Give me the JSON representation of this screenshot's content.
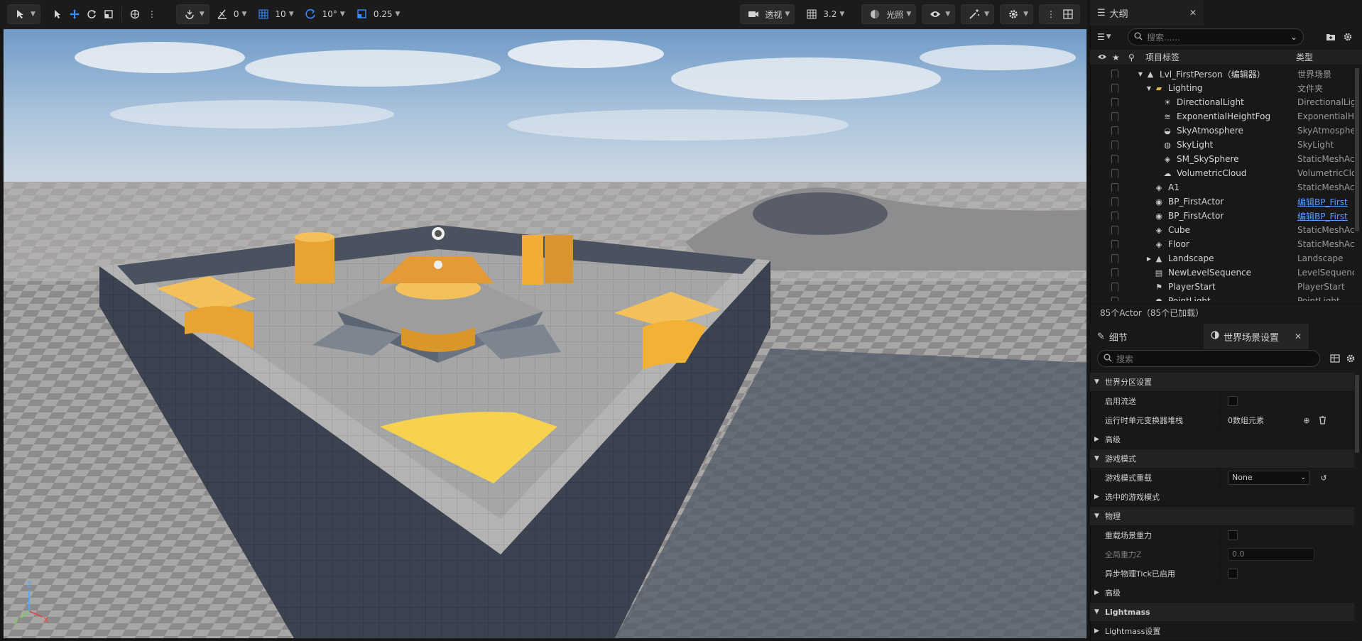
{
  "toolbar": {
    "snap_angle": "0",
    "grid_size": "10",
    "rotation_snap": "10°",
    "scale_snap": "0.25",
    "view_mode": "透视",
    "camera_speed": "3.2",
    "lighting_mode": "光照"
  },
  "outliner": {
    "tab_label": "大纲",
    "search_placeholder": "搜索......",
    "col_label": "项目标签",
    "col_type": "类型",
    "rows": [
      {
        "name": "Lvl_FirstPerson（编辑器）",
        "type": "世界场景",
        "icon": "level-icon"
      },
      {
        "name": "Lighting",
        "type": "文件夹",
        "icon": "folder-icon"
      },
      {
        "name": "DirectionalLight",
        "type": "DirectionalLig",
        "icon": "directional-light-icon"
      },
      {
        "name": "ExponentialHeightFog",
        "type": "ExponentialHe",
        "icon": "fog-icon"
      },
      {
        "name": "SkyAtmosphere",
        "type": "SkyAtmosphe",
        "icon": "sky-atmosphere-icon"
      },
      {
        "name": "SkyLight",
        "type": "SkyLight",
        "icon": "sky-light-icon"
      },
      {
        "name": "SM_SkySphere",
        "type": "StaticMeshAc",
        "icon": "static-mesh-icon"
      },
      {
        "name": "VolumetricCloud",
        "type": "VolumetricClo",
        "icon": "cloud-icon"
      },
      {
        "name": "A1",
        "type": "StaticMeshAc",
        "icon": "static-mesh-icon"
      },
      {
        "name": "BP_FirstActor",
        "type": "编辑BP_First",
        "icon": "blueprint-icon"
      },
      {
        "name": "BP_FirstActor",
        "type": "编辑BP_First",
        "icon": "blueprint-icon"
      },
      {
        "name": "Cube",
        "type": "StaticMeshAc",
        "icon": "static-mesh-icon"
      },
      {
        "name": "Floor",
        "type": "StaticMeshAc",
        "icon": "static-mesh-icon"
      },
      {
        "name": "Landscape",
        "type": "Landscape",
        "icon": "landscape-icon"
      },
      {
        "name": "NewLevelSequence",
        "type": "LevelSequenc",
        "icon": "sequence-icon"
      },
      {
        "name": "PlayerStart",
        "type": "PlayerStart",
        "icon": "player-start-icon"
      },
      {
        "name": "PointLight",
        "type": "PointLight",
        "icon": "point-light-icon"
      }
    ],
    "status": "85个Actor（85个已加载）"
  },
  "details": {
    "tab_details": "细节",
    "tab_world_settings": "世界场景设置",
    "search_placeholder": "搜索",
    "rows": [
      {
        "kind": "cat",
        "label": "世界分区设置",
        "open": true
      },
      {
        "kind": "check",
        "label": "启用流送"
      },
      {
        "kind": "array",
        "label": "运行时单元变换器堆栈",
        "value": "0数组元素"
      },
      {
        "kind": "sub",
        "label": "高级"
      },
      {
        "kind": "cat",
        "label": "游戏模式",
        "open": true
      },
      {
        "kind": "dropdown",
        "label": "游戏模式重载",
        "value": "None"
      },
      {
        "kind": "sub",
        "label": "选中的游戏模式"
      },
      {
        "kind": "cat",
        "label": "物理",
        "open": true
      },
      {
        "kind": "check",
        "label": "重载场景重力"
      },
      {
        "kind": "number",
        "label": "全局重力Z",
        "value": "0.0",
        "dim": true
      },
      {
        "kind": "check",
        "label": "异步物理Tick已启用"
      },
      {
        "kind": "sub",
        "label": "高级"
      },
      {
        "kind": "catbold",
        "label": "Lightmass",
        "open": true
      },
      {
        "kind": "sub",
        "label": "Lightmass设置"
      }
    ]
  },
  "colors": {
    "accent_blue": "#3a8dff",
    "link": "#5a9bff",
    "mesh_yellow": "#f6b63c",
    "wall_blue": "#3a4250"
  }
}
